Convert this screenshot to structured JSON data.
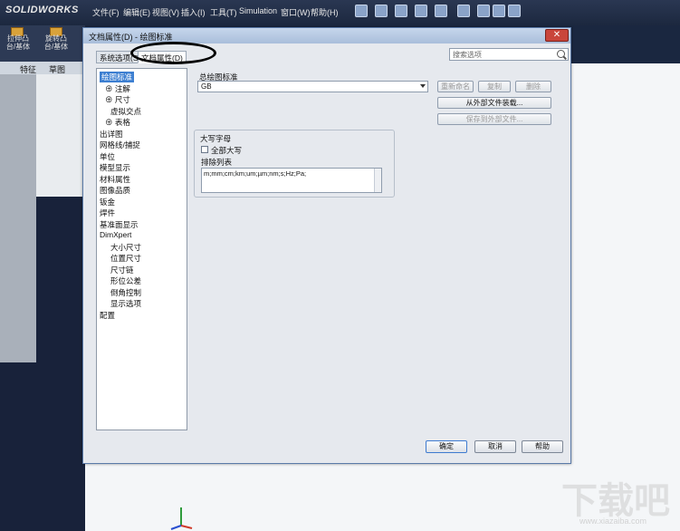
{
  "app": {
    "logo": "SOLIDWORKS",
    "menu": [
      "文件(F)",
      "编辑(E)",
      "视图(V)",
      "插入(I)",
      "工具(T)",
      "Simulation",
      "窗口(W)",
      "帮助(H)"
    ],
    "command_buttons": [
      {
        "label": "拉伸凸台/基体"
      },
      {
        "label": "旋转凸台/基体"
      }
    ],
    "feature_tabs": [
      "特征",
      "草图"
    ]
  },
  "dialog": {
    "title": "文档属性(D) - 绘图标准",
    "close_label": "✕",
    "tabs": [
      "系统选项(S)",
      "文档属性(D)"
    ],
    "active_tab": "文档属性(D)",
    "search_placeholder": "搜索选项",
    "tree": [
      {
        "label": "绘图标准",
        "indent": 0,
        "selected": true
      },
      {
        "label": "注解",
        "indent": 1,
        "expander": "⊕"
      },
      {
        "label": "尺寸",
        "indent": 1,
        "expander": "⊕"
      },
      {
        "label": "虚拟交点",
        "indent": 2
      },
      {
        "label": "表格",
        "indent": 1,
        "expander": "⊕"
      },
      {
        "label": "出详图",
        "indent": 0
      },
      {
        "label": "网格线/捕捉",
        "indent": 0
      },
      {
        "label": "单位",
        "indent": 0
      },
      {
        "label": "模型显示",
        "indent": 0
      },
      {
        "label": "材料属性",
        "indent": 0
      },
      {
        "label": "图像品质",
        "indent": 0
      },
      {
        "label": "钣金",
        "indent": 0
      },
      {
        "label": "焊件",
        "indent": 0
      },
      {
        "label": "基准面显示",
        "indent": 0
      },
      {
        "label": "DimXpert",
        "indent": 0
      },
      {
        "label": "大小尺寸",
        "indent": 2
      },
      {
        "label": "位置尺寸",
        "indent": 2
      },
      {
        "label": "尺寸链",
        "indent": 2
      },
      {
        "label": "形位公差",
        "indent": 2
      },
      {
        "label": "倒角控制",
        "indent": 2
      },
      {
        "label": "显示选项",
        "indent": 2
      },
      {
        "label": "配置",
        "indent": 0
      }
    ],
    "standard": {
      "label": "总绘图标准",
      "value": "GB",
      "buttons": {
        "rename": "重新命名",
        "copy": "复制",
        "delete": "删除",
        "load": "从外部文件装载...",
        "save": "保存到外部文件..."
      }
    },
    "uppercase": {
      "label": "大写字母",
      "all_caps_label": "全部大写",
      "all_caps_checked": false,
      "exclusion_label": "排除列表",
      "exclusion_value": "m;mm;cm;km;um;µm;nm;s;Hz;Pa;"
    },
    "footer": {
      "ok": "确定",
      "cancel": "取消",
      "help": "帮助"
    }
  },
  "watermark": {
    "main": "下载吧",
    "sub": "www.xiazaiba.com"
  }
}
